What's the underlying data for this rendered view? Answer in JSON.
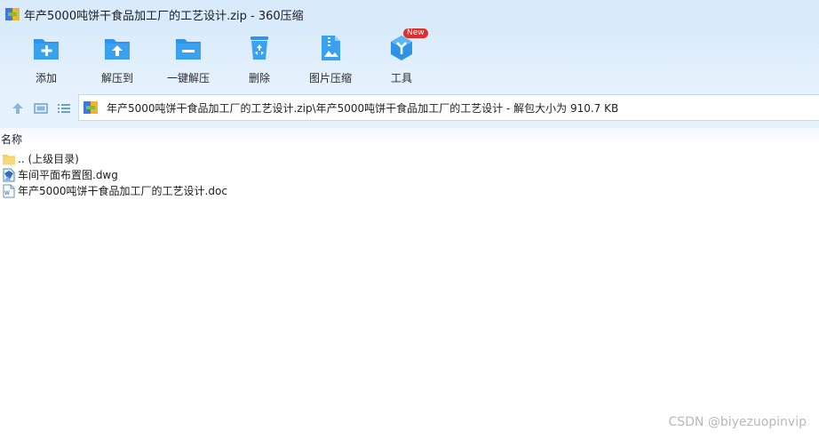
{
  "window": {
    "title": "年产5000吨饼干食品加工厂的工艺设计.zip - 360压缩"
  },
  "toolbar": {
    "items": [
      {
        "label": "添加",
        "icon": "add-folder-icon"
      },
      {
        "label": "解压到",
        "icon": "extract-to-icon"
      },
      {
        "label": "一键解压",
        "icon": "one-click-extract-icon"
      },
      {
        "label": "删除",
        "icon": "recycle-bin-icon"
      },
      {
        "label": "图片压缩",
        "icon": "image-compress-icon"
      },
      {
        "label": "工具",
        "icon": "tools-icon",
        "badge": "New"
      }
    ]
  },
  "navigation": {
    "up_icon": "up-arrow-icon",
    "view_thumbnail_icon": "thumbnail-view-icon",
    "view_list_icon": "list-view-icon"
  },
  "address_bar": {
    "path": "年产5000吨饼干食品加工厂的工艺设计.zip\\年产5000吨饼干食品加工厂的工艺设计 - 解包大小为 910.7 KB"
  },
  "file_list": {
    "column_header": "名称",
    "rows": [
      {
        "name": ".. (上级目录)",
        "icon": "folder-icon"
      },
      {
        "name": "车间平面布置图.dwg",
        "icon": "dwg-file-icon"
      },
      {
        "name": "年产5000吨饼干食品加工厂的工艺设计.doc",
        "icon": "doc-file-icon"
      }
    ]
  },
  "watermark": "CSDN @biyezuopinvip",
  "colors": {
    "toolbar_bg": "#d9ebfb",
    "icon_blue": "#2f93e8",
    "badge_red": "#e32b2b"
  }
}
